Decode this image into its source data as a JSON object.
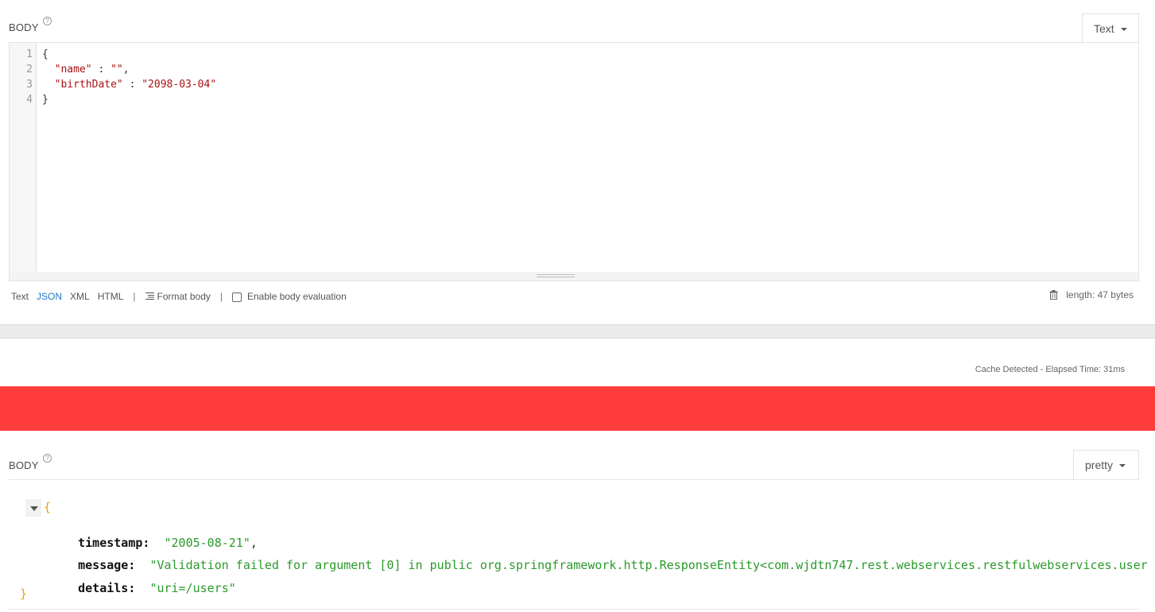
{
  "request": {
    "label": "BODY",
    "help": "?",
    "type_dropdown": "Text",
    "editor": {
      "line_numbers": [
        "1",
        "2",
        "3",
        "4"
      ],
      "lines": [
        [
          {
            "t": "punct",
            "v": "{"
          }
        ],
        [
          {
            "t": "punct",
            "v": "  "
          },
          {
            "t": "key",
            "v": "\"name\""
          },
          {
            "t": "punct",
            "v": " : "
          },
          {
            "t": "str",
            "v": "\"\""
          },
          {
            "t": "punct",
            "v": ","
          }
        ],
        [
          {
            "t": "punct",
            "v": "  "
          },
          {
            "t": "key",
            "v": "\"birthDate\""
          },
          {
            "t": "punct",
            "v": " : "
          },
          {
            "t": "str",
            "v": "\"2098-03-04\""
          }
        ],
        [
          {
            "t": "punct",
            "v": "}"
          }
        ]
      ]
    },
    "toolbar": {
      "text": "Text",
      "json": "JSON",
      "xml": "XML",
      "html": "HTML",
      "separator": "|",
      "format_body": "Format body",
      "enable_eval": "Enable body evaluation",
      "length": "length: 47 bytes"
    }
  },
  "status": {
    "elapsed": "Cache Detected -  Elapsed Time: 31ms",
    "color": "#ff3d3d"
  },
  "response": {
    "label": "BODY",
    "help": "?",
    "view_dropdown": "pretty",
    "open_brace": "{",
    "close_brace": "}",
    "fields": [
      {
        "key": "timestamp:",
        "value": "\"2005-08-21\"",
        "comma": ","
      },
      {
        "key": "message:",
        "value": "\"Validation failed for argument [0] in public org.springframework.http.ResponseEntity<com.wjdtn747.rest.webservices.restfulwebservices.user",
        "comma": ""
      },
      {
        "key": "details:",
        "value": "\"uri=/users\"",
        "comma": ""
      }
    ]
  }
}
